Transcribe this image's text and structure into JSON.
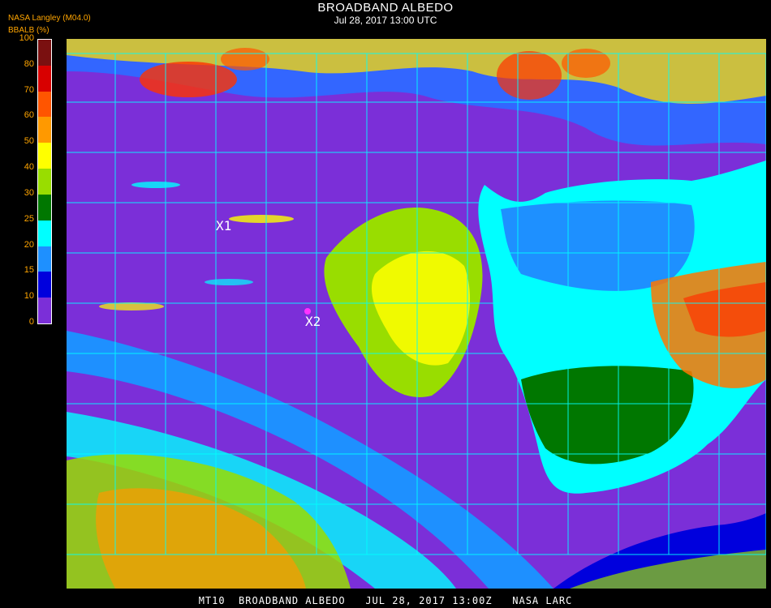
{
  "header": {
    "title": "BROADBAND ALBEDO",
    "subtitle": "Jul 28, 2017 13:00 UTC",
    "source": "NASA Langley (M04.0)",
    "unit": "BBALB (%)"
  },
  "legend": {
    "ticks": [
      "100",
      "80",
      "70",
      "60",
      "50",
      "40",
      "30",
      "25",
      "20",
      "15",
      "10",
      "0"
    ],
    "colors": [
      "#7a1010",
      "#d80000",
      "#ff5500",
      "#ff9900",
      "#ffff00",
      "#99dd00",
      "#007700",
      "#00ffff",
      "#1e90ff",
      "#0000dd",
      "#7b2fd8"
    ]
  },
  "map": {
    "markers": [
      "X1",
      "X2"
    ],
    "grid_color": "#00ffff",
    "ocean_color": "#7b2fd8"
  },
  "footer": {
    "text": "MT10  BROADBAND ALBEDO   JUL 28, 2017 13:00Z   NASA LARC"
  }
}
